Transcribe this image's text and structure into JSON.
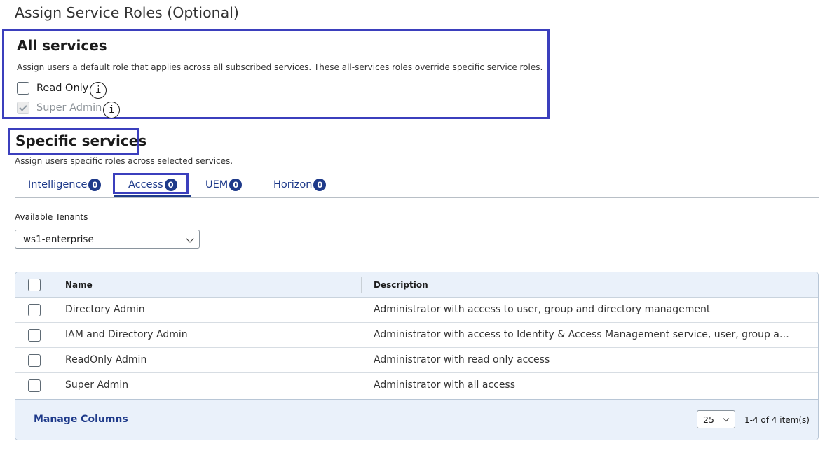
{
  "page": {
    "title": "Assign Service Roles (Optional)"
  },
  "all_services": {
    "title": "All services",
    "description": "Assign users a default role that applies across all subscribed services. These all-services roles override specific service roles.",
    "roles": [
      {
        "label": "Read Only",
        "checked": false,
        "disabled": false,
        "info_icon": "info-icon"
      },
      {
        "label": "Super Admin",
        "checked": true,
        "disabled": true,
        "info_icon": "info-icon"
      }
    ]
  },
  "specific_services": {
    "title": "Specific services",
    "description": "Assign users specific roles across selected services.",
    "tabs": [
      {
        "label": "Intelligence",
        "count": "0"
      },
      {
        "label": "Access",
        "count": "0",
        "active": true
      },
      {
        "label": "UEM",
        "count": "0"
      },
      {
        "label": "Horizon",
        "count": "0"
      }
    ]
  },
  "tenants": {
    "label": "Available Tenants",
    "selected": "ws1-enterprise"
  },
  "grid": {
    "columns": {
      "name": "Name",
      "description": "Description"
    },
    "rows": [
      {
        "name": "Directory Admin",
        "description": "Administrator with access to user, group and directory management"
      },
      {
        "name": "IAM and Directory Admin",
        "description": "Administrator with access to Identity & Access Management service, user, group and..."
      },
      {
        "name": "ReadOnly Admin",
        "description": "Administrator with read only access"
      },
      {
        "name": "Super Admin",
        "description": "Administrator with all access"
      }
    ],
    "footer": {
      "manage_columns": "Manage Columns",
      "page_size": "25",
      "count_text": "1-4 of 4 item(s)"
    }
  },
  "colors": {
    "accent": "#1e3a8a",
    "highlight_box": "#3b3fbd",
    "grid_header_bg": "#eaf1fa"
  }
}
